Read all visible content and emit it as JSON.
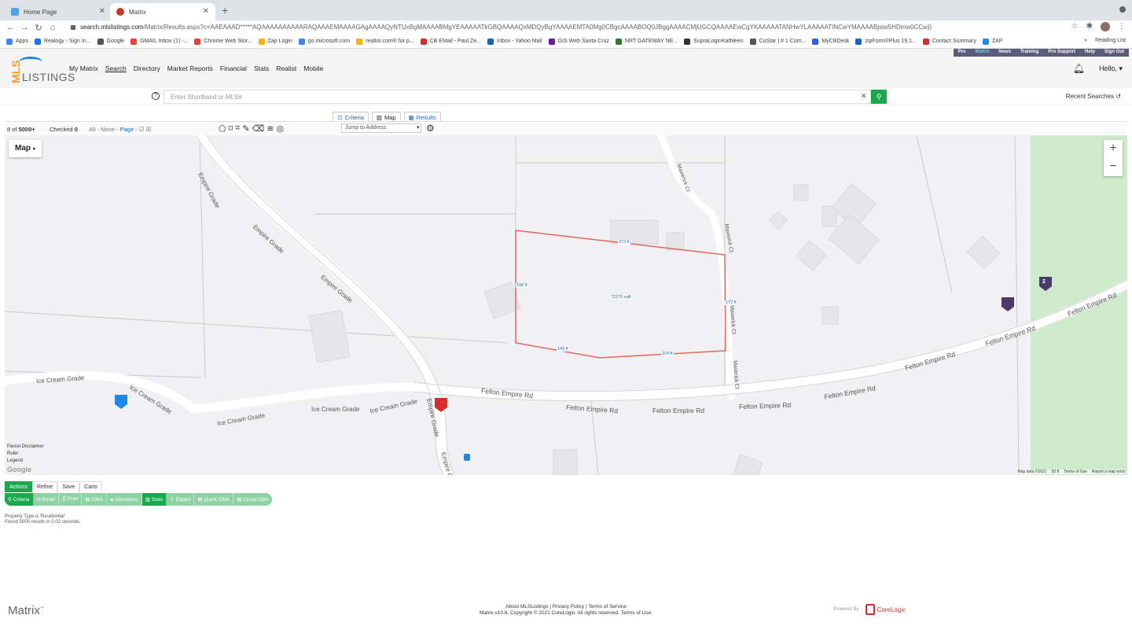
{
  "browser": {
    "tabs": [
      {
        "label": "Home Page",
        "active": false
      },
      {
        "label": "Matrix",
        "active": true
      }
    ],
    "url_host": "search.mlslistings.com",
    "url_path": "/Matrix/Results.aspx?c=AAEAAAD*****AQAAAAAAAAAARAQAAAEMAAAAGAgAAAAQyNTUxBgMAAAABMgYEAAAAATkGBQAAAAQxMDQyBgYAAAAEMTA0Mg0CBgcAAAABOQ0JBggAAAACMjUGCQAAAAEwCgYKAAAAATANHwYLAAAAATINCwYMAAAABjsiw5HDmw0CCw))",
    "bookmarks": [
      "Apps",
      "Realogy - Sign In...",
      "Google",
      "GMAIL Inbox (1) -...",
      "Chrome Web Stor...",
      "Zap Login",
      "go.microsoft.com",
      "realtor.com® for p...",
      "CB EMail - Paul.Ze...",
      "Inbox - Yahoo Mail",
      "GIS Web Santa Cruz",
      "NRT GATEWAY NE...",
      "SupraLoginKathleen",
      "CoStar | # 1 Com...",
      "MyCBDesk",
      "zipForm®Plus 19.1...",
      "Contact Summary",
      "ZAP"
    ],
    "bookmarks_more": "»",
    "reading_list": "Reading List"
  },
  "topstrip": [
    "Pro",
    "Matrix",
    "News",
    "Training",
    "Pro Support",
    "Help",
    "Sign Out"
  ],
  "header": {
    "logo_mls": "MLS",
    "logo_listings": "LISTINGS",
    "nav": [
      "My Matrix",
      "Search",
      "Directory",
      "Market Reports",
      "Financial",
      "Stats",
      "Realist",
      "Mobile"
    ],
    "greeting": "Hello,"
  },
  "search": {
    "placeholder": "Enter Shorthand or MLS#",
    "recent": "Recent Searches"
  },
  "viewtabs": [
    "Criteria",
    "Map",
    "Results"
  ],
  "toolbar": {
    "count_prefix": "8 of ",
    "count_total": "5000+",
    "checked_label": "Checked ",
    "checked_value": "0",
    "select_all": "All",
    "select_none": "None",
    "select_page": "Page",
    "jump_placeholder": "Jump to Address"
  },
  "map": {
    "type_label": "Map",
    "roads": [
      "Empire Grade",
      "Empire Grade",
      "Empire Grade",
      "Ice Cream Grade",
      "Ice Cream Grade",
      "Ice Cream Grade",
      "Ice Cream Grade",
      "Ice Cream Grade",
      "Empire Grade",
      "Empire G",
      "Felton Empire Rd",
      "Felton Empire Rd",
      "Felton Empire Rd",
      "Felton Empire Rd",
      "Felton Empire Rd",
      "Felton Empire Rd",
      "Felton Empire Rd",
      "Felton Empire Rd",
      "Maverick Ct",
      "Maverick Ct",
      "Maverick Ct",
      "Maverick Ct"
    ],
    "parcel_labels": [
      "373 ft",
      "198 ft",
      "72276 sqft",
      "172 ft",
      "149 ft",
      "224 ft"
    ],
    "cluster_count": "2",
    "side_links": [
      "Parcel Disclaimer",
      "Ruler",
      "Legend"
    ],
    "google": "Google",
    "footer": [
      "Map data ©2021",
      "50 ft",
      "Terms of Use",
      "Report a map error"
    ]
  },
  "actions": {
    "tabs": [
      "Actions",
      "Refine",
      "Save",
      "Carts"
    ],
    "buttons": [
      "Criteria",
      "Email",
      "Print",
      "CMA",
      "Directions",
      "Stats",
      "Export",
      "Quick CMA",
      "Cloud CMA"
    ]
  },
  "notes": [
    "Property Type is 'Residential'",
    "Found 5000 results in 0.02 seconds."
  ],
  "footer": {
    "brand": "Matrix",
    "links": "About MLSListings | Privacy Policy | Terms of Service",
    "copyright": "Matrix v10.6. Copyright © 2021 CoreLogic. All rights reserved. Terms of Use.",
    "powered": "Powered By",
    "corelogic": "CoreLogic"
  }
}
